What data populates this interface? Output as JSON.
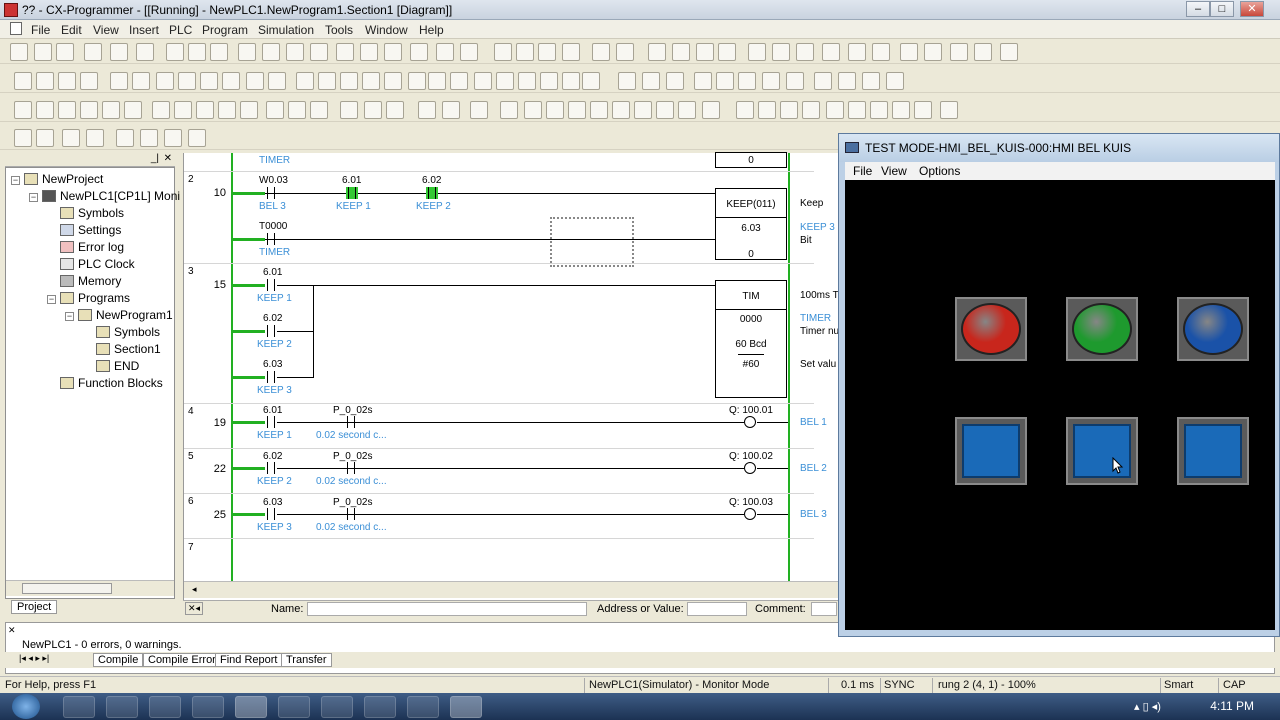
{
  "window": {
    "title": "?? - CX-Programmer - [[Running] - NewPLC1.NewProgram1.Section1 [Diagram]]",
    "minimize": "–",
    "maximize": "□",
    "close": "✕"
  },
  "menu": [
    "File",
    "Edit",
    "View",
    "Insert",
    "PLC",
    "Program",
    "Simulation",
    "Tools",
    "Window",
    "Help"
  ],
  "project_tree": {
    "items": [
      {
        "label": "NewProject",
        "icon": "project-icon"
      },
      {
        "label": "NewPLC1[CP1L] Moni",
        "icon": "plc-icon"
      },
      {
        "label": "Symbols",
        "icon": "symbols-icon"
      },
      {
        "label": "Settings",
        "icon": "settings-icon"
      },
      {
        "label": "Error log",
        "icon": "error-log-icon"
      },
      {
        "label": "PLC Clock",
        "icon": "clock-icon"
      },
      {
        "label": "Memory",
        "icon": "memory-icon"
      },
      {
        "label": "Programs",
        "icon": "programs-icon"
      },
      {
        "label": "NewProgram1",
        "icon": "program-icon"
      },
      {
        "label": "Symbols",
        "icon": "symbols-icon"
      },
      {
        "label": "Section1",
        "icon": "section-icon"
      },
      {
        "label": "END",
        "icon": "end-icon"
      },
      {
        "label": "Function Blocks",
        "icon": "function-blocks-icon"
      }
    ],
    "tab_label": "Project"
  },
  "ladder": {
    "top_timer_label": "TIMER",
    "top_value": "0",
    "rungs": [
      {
        "num": "2",
        "step": "10"
      },
      {
        "num": "3",
        "step": "15"
      },
      {
        "num": "4",
        "step": "19"
      },
      {
        "num": "5",
        "step": "22"
      },
      {
        "num": "6",
        "step": "25"
      },
      {
        "num": "7",
        "step": ""
      }
    ],
    "r2": {
      "c1_addr": "W0.03",
      "c1_name": "BEL 3",
      "c2_addr": "6.01",
      "c2_name": "KEEP 1",
      "c3_addr": "6.02",
      "c3_name": "KEEP 2",
      "c4_addr": "T0000",
      "c4_name": "TIMER",
      "box_title": "KEEP(011)",
      "box_addr": "6.03",
      "box_val": "0",
      "side1": "Keep",
      "side2": "KEEP 3",
      "side3": "Bit"
    },
    "r3": {
      "c1_addr": "6.01",
      "c1_name": "KEEP 1",
      "c2_addr": "6.02",
      "c2_name": "KEEP 2",
      "c3_addr": "6.03",
      "c3_name": "KEEP 3",
      "box_title": "TIM",
      "box_addr": "0000",
      "box_bcd": "60 Bcd",
      "box_set": "#60",
      "side1": "100ms T",
      "side2": "TIMER",
      "side3": "Timer nu",
      "side4": "Set valu"
    },
    "r4": {
      "c1_addr": "6.01",
      "c1_name": "KEEP 1",
      "c2_addr": "P_0_02s",
      "c2_name": "0.02 second c...",
      "out_addr": "Q: 100.01",
      "out_name": "BEL 1"
    },
    "r5": {
      "c1_addr": "6.02",
      "c1_name": "KEEP 2",
      "c2_addr": "P_0_02s",
      "c2_name": "0.02 second c...",
      "out_addr": "Q: 100.02",
      "out_name": "BEL 2"
    },
    "r6": {
      "c1_addr": "6.03",
      "c1_name": "KEEP 3",
      "c2_addr": "P_0_02s",
      "c2_name": "0.02 second c...",
      "out_addr": "Q: 100.03",
      "out_name": "BEL 3"
    }
  },
  "diagram_bottom": {
    "name_label": "Name:",
    "address_label": "Address or Value:",
    "comment_label": "Comment:"
  },
  "output": {
    "message": "NewPLC1 - 0 errors, 0 warnings.",
    "tabs": [
      "Compile",
      "Compile Error",
      "Find Report",
      "Transfer"
    ]
  },
  "status": {
    "help": "For Help, press F1",
    "mode": "NewPLC1(Simulator) - Monitor Mode",
    "cycle": "0.1 ms",
    "sync": "SYNC",
    "position": "rung 2 (4, 1)  - 100%",
    "smart": "Smart",
    "cap": "CAP"
  },
  "taskbar": {
    "clock": "4:11 PM"
  },
  "hmi": {
    "title": "TEST MODE-HMI_BEL_KUIS-000:HMI BEL KUIS",
    "menu": [
      "File",
      "View",
      "Options"
    ],
    "lamps": [
      {
        "name": "red-lamp",
        "color": "#c8261c"
      },
      {
        "name": "green-lamp",
        "color": "#1e9a2e"
      },
      {
        "name": "blue-lamp",
        "color": "#1a52a8"
      }
    ],
    "buttons_color": "#1a6ab8"
  }
}
